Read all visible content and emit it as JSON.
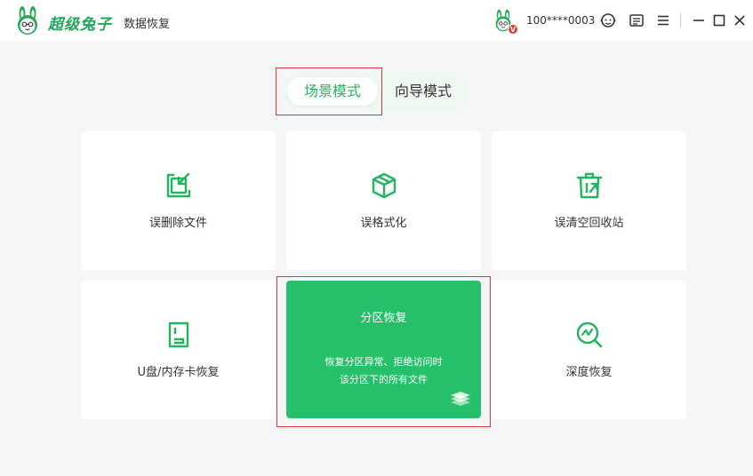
{
  "app": {
    "brand_name": "超级兔子",
    "product_name": "数据恢复"
  },
  "user": {
    "phone_masked": "100****0003",
    "vip_badge": "V"
  },
  "window_controls": {
    "icons": [
      "support-icon",
      "message-icon",
      "menu-icon",
      "minimize-icon",
      "maximize-icon",
      "close-icon"
    ]
  },
  "mode_switch": {
    "scene_mode": "场景模式",
    "guide_mode": "向导模式",
    "active": "scene_mode"
  },
  "cards": {
    "deleted_files": {
      "label": "误删除文件",
      "icon": "file-restore-icon"
    },
    "formatted": {
      "label": "误格式化",
      "icon": "cube-icon"
    },
    "recycle_bin": {
      "label": "误清空回收站",
      "icon": "trash-icon"
    },
    "usb_card": {
      "label": "U盘/内存卡恢复",
      "icon": "sd-card-icon"
    },
    "partition": {
      "title": "分区恢复",
      "desc_line1": "恢复分区异常、拒绝访问时",
      "desc_line2": "该分区下的所有文件",
      "icon": "layers-icon"
    },
    "deep": {
      "label": "深度恢复",
      "icon": "magnifier-chart-icon"
    }
  },
  "colors": {
    "brand_green": "#22b55f",
    "card_highlight": "#26c06a",
    "highlight_border": "#d9363e",
    "background": "#f5f6f7"
  }
}
